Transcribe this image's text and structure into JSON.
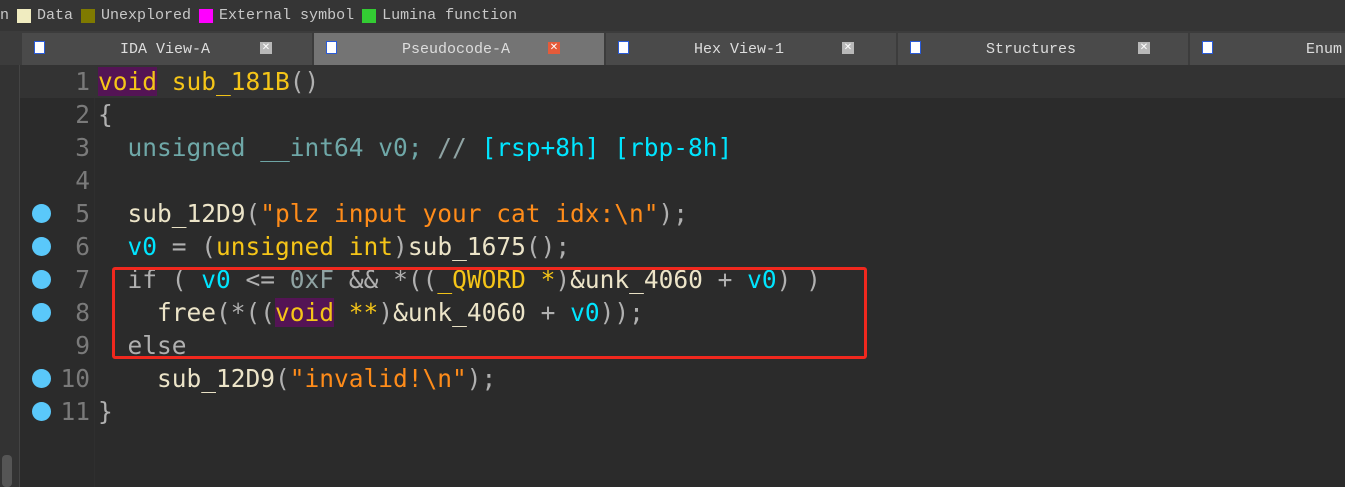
{
  "legend": {
    "items": [
      {
        "label": "Data",
        "color": "#f0ecc0"
      },
      {
        "label": "Unexplored",
        "color": "#7f7a00"
      },
      {
        "label": "External symbol",
        "color": "#ff00ff"
      },
      {
        "label": "Lumina function",
        "color": "#33cc33"
      }
    ],
    "partial": "n"
  },
  "tabs": [
    {
      "label": "IDA View-A",
      "active": false
    },
    {
      "label": "Pseudocode-A",
      "active": true
    },
    {
      "label": "Hex View-1",
      "active": false
    },
    {
      "label": "Structures",
      "active": false
    },
    {
      "label": "Enum",
      "active": false
    }
  ],
  "code": {
    "lines": [
      {
        "n": "1",
        "bp": false,
        "tokens": [
          [
            "kw kwbg",
            "void"
          ],
          [
            "plain",
            " "
          ],
          [
            "fn",
            "sub_181B"
          ],
          [
            "gray",
            "()"
          ]
        ]
      },
      {
        "n": "2",
        "bp": false,
        "tokens": [
          [
            "gray",
            "{"
          ]
        ]
      },
      {
        "n": "3",
        "bp": false,
        "tokens": [
          [
            "ty",
            "  unsigned __int64 v0; "
          ],
          [
            "cmt",
            "// "
          ],
          [
            "var",
            "[rsp+8h] [rbp-8h]"
          ]
        ]
      },
      {
        "n": "4",
        "bp": false,
        "tokens": []
      },
      {
        "n": "5",
        "bp": true,
        "tokens": [
          [
            "plain",
            "  sub_12D9"
          ],
          [
            "gray",
            "("
          ],
          [
            "str",
            "\"plz input your cat idx:\\n\""
          ],
          [
            "gray",
            ");"
          ]
        ]
      },
      {
        "n": "6",
        "bp": true,
        "tokens": [
          [
            "var",
            "  v0"
          ],
          [
            "gray",
            " = ("
          ],
          [
            "kw",
            "unsigned int"
          ],
          [
            "gray",
            ")"
          ],
          [
            "plain",
            "sub_1675"
          ],
          [
            "gray",
            "();"
          ]
        ]
      },
      {
        "n": "7",
        "bp": true,
        "tokens": [
          [
            "gray",
            "  if ( "
          ],
          [
            "var",
            "v0"
          ],
          [
            "gray",
            " <= "
          ],
          [
            "num",
            "0xF"
          ],
          [
            "gray",
            " && *(("
          ],
          [
            "kw",
            "_QWORD *"
          ],
          [
            "gray",
            ")"
          ],
          [
            "plain",
            "&unk_4060"
          ],
          [
            "gray",
            " + "
          ],
          [
            "var",
            "v0"
          ],
          [
            "gray",
            ") )"
          ]
        ]
      },
      {
        "n": "8",
        "bp": true,
        "tokens": [
          [
            "plain",
            "    free"
          ],
          [
            "gray",
            "(*(("
          ],
          [
            "kw kwbg",
            "void"
          ],
          [
            "kw",
            " **"
          ],
          [
            "gray",
            ")"
          ],
          [
            "plain",
            "&unk_4060"
          ],
          [
            "gray",
            " + "
          ],
          [
            "var",
            "v0"
          ],
          [
            "gray",
            "));"
          ]
        ]
      },
      {
        "n": "9",
        "bp": false,
        "tokens": [
          [
            "gray",
            "  else"
          ]
        ]
      },
      {
        "n": "10",
        "bp": true,
        "tokens": [
          [
            "plain",
            "    sub_12D9"
          ],
          [
            "gray",
            "("
          ],
          [
            "str",
            "\"invalid!\\n\""
          ],
          [
            "gray",
            ");"
          ]
        ]
      },
      {
        "n": "11",
        "bp": true,
        "tokens": [
          [
            "gray",
            "}"
          ]
        ]
      }
    ]
  }
}
